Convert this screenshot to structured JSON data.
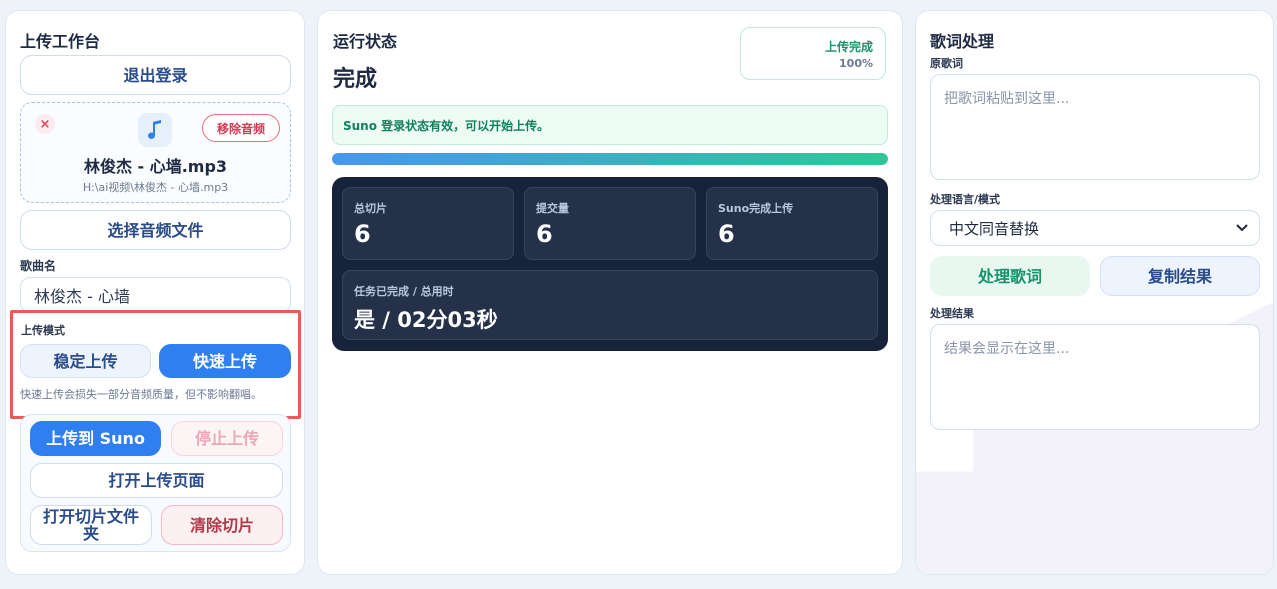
{
  "left": {
    "title": "上传工作台",
    "logout": "退出登录",
    "audio": {
      "close": "×",
      "remove": "移除音频",
      "file_name": "林俊杰 - 心墙.mp3",
      "file_path": "H:\\ai视频\\林俊杰 - 心墙.mp3"
    },
    "choose_file": "选择音频文件",
    "song_label": "歌曲名",
    "song_value": "林俊杰 - 心墙",
    "mode_label": "上传模式",
    "mode_stable": "稳定上传",
    "mode_fast": "快速上传",
    "mode_note": "快速上传会损失一部分音频质量，但不影响翻唱。",
    "upload_suno": "上传到 Suno",
    "stop_upload": "停止上传",
    "open_upload_page": "打开上传页面",
    "open_slice_folder": "打开切片文件夹",
    "clear_slices": "清除切片"
  },
  "mid": {
    "title": "运行状态",
    "state": "完成",
    "badge_label": "上传完成",
    "badge_pct": "100%",
    "progress": 100,
    "alert": "Suno 登录状态有效，可以开始上传。",
    "stats": [
      {
        "label": "总切片",
        "value": "6"
      },
      {
        "label": "提交量",
        "value": "6"
      },
      {
        "label": "Suno完成上传",
        "value": "6"
      }
    ],
    "summary": {
      "label": "任务已完成 / 总用时",
      "value": "是 / 02分03秒"
    }
  },
  "right": {
    "title": "歌词处理",
    "orig_label": "原歌词",
    "orig_placeholder": "把歌词粘贴到这里...",
    "lang_label": "处理语言/模式",
    "lang_value": "中文同音替换",
    "process": "处理歌词",
    "copy": "复制结果",
    "result_label": "处理结果",
    "result_placeholder": "结果会显示在这里..."
  },
  "colors": {
    "primary": "#2f7ff0",
    "success": "#18936a",
    "danger": "#d63a52",
    "dark": "#17233a"
  },
  "icons": {
    "audio": "music-note-icon",
    "close": "close-icon",
    "select": "chevron-down-icon"
  }
}
